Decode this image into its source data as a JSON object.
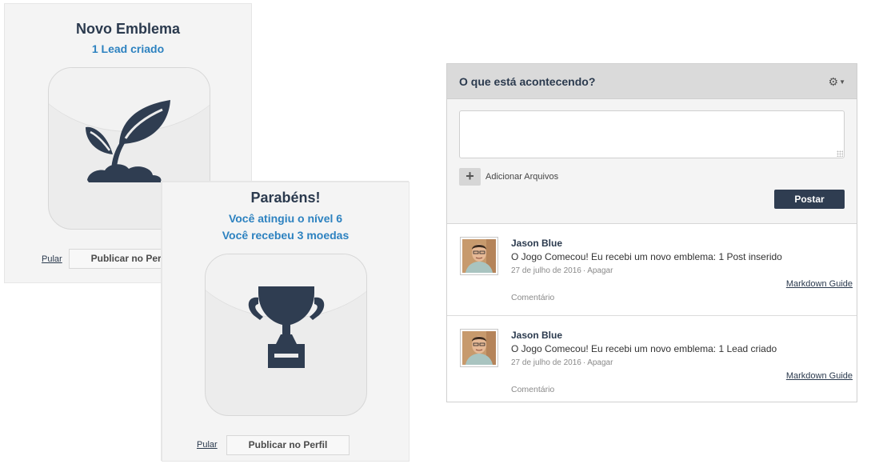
{
  "badge_card_1": {
    "title": "Novo Emblema",
    "subtitle": "1 Lead criado",
    "icon": "sprout-icon",
    "skip_label": "Pular",
    "publish_label": "Publicar no Perfil"
  },
  "badge_card_2": {
    "title": "Parabéns!",
    "subtitle_1": "Você atingiu o nível 6",
    "subtitle_2": "Você recebeu 3 moedas",
    "icon": "trophy-icon",
    "skip_label": "Pular",
    "publish_label": "Publicar no Perfil"
  },
  "feed": {
    "title": "O que está acontecendo?",
    "settings_icon": "gear-icon",
    "composer_value": "",
    "attach_label": "Adicionar Arquivos",
    "post_label": "Postar",
    "items": [
      {
        "author": "Jason Blue",
        "message": "O Jogo Comecou! Eu recebi um novo emblema: 1 Post inserido",
        "date": "27 de julho de 2016",
        "separator": "·",
        "delete_label": "Apagar",
        "markdown_label": "Markdown Guide",
        "comment_label": "Comentário"
      },
      {
        "author": "Jason Blue",
        "message": "O Jogo Comecou! Eu recebi um novo emblema: 1 Lead criado",
        "date": "27 de julho de 2016",
        "separator": "·",
        "delete_label": "Apagar",
        "markdown_label": "Markdown Guide",
        "comment_label": "Comentário"
      }
    ]
  },
  "colors": {
    "navy": "#2b3a4e",
    "accent_blue": "#2d82c0",
    "post_button": "#2f3d51"
  }
}
